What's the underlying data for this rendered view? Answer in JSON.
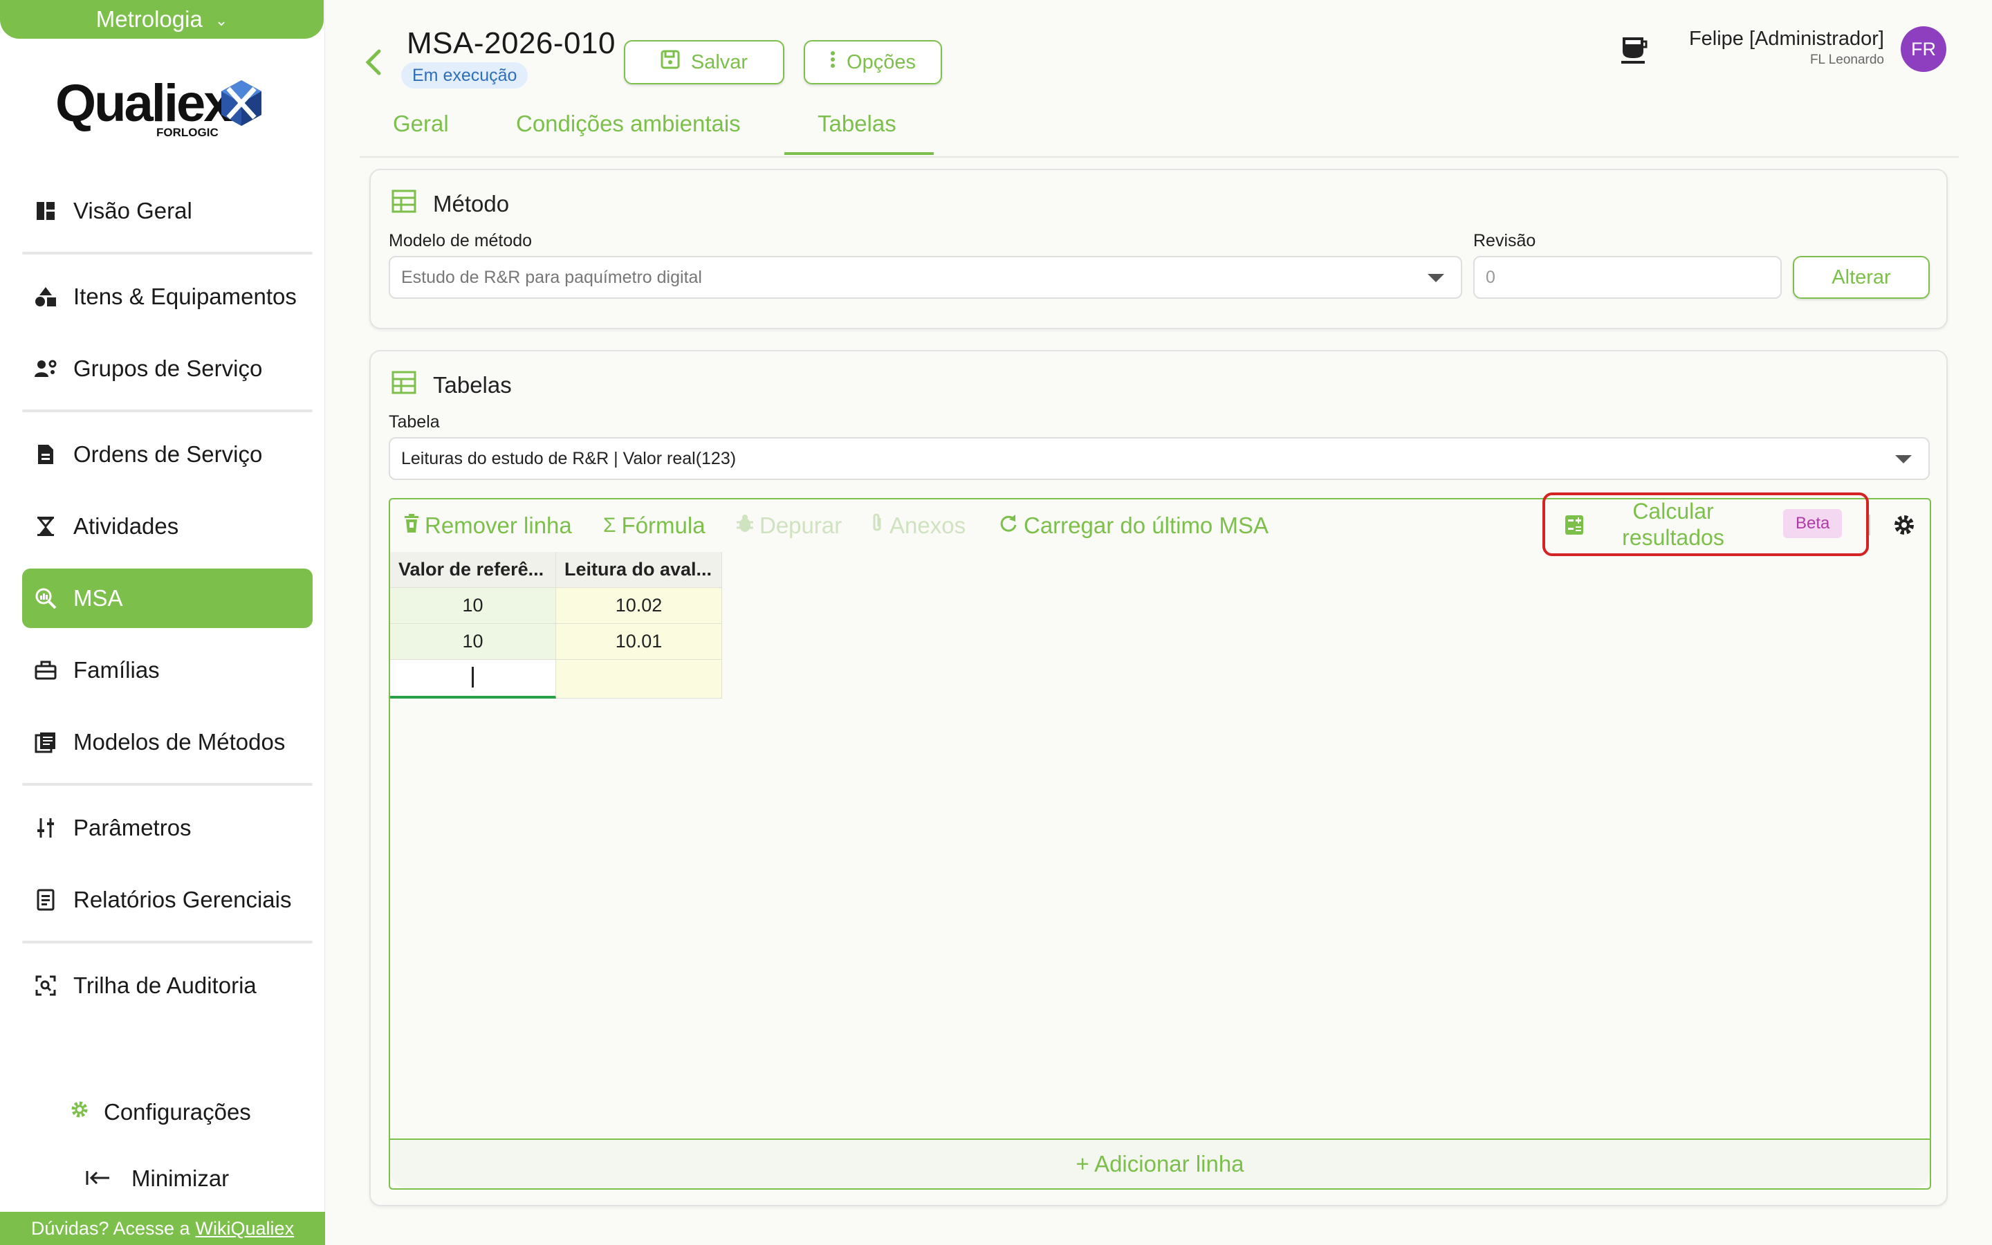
{
  "sidebar": {
    "module": "Metrologia",
    "logo_text": "Qualiex",
    "logo_sub": "FORLOGIC",
    "items": [
      {
        "label": "Visão Geral",
        "icon": "dashboard-icon"
      },
      {
        "label": "Itens & Equipamentos",
        "icon": "shapes-icon"
      },
      {
        "label": "Grupos de Serviço",
        "icon": "users-gear-icon"
      },
      {
        "label": "Ordens de Serviço",
        "icon": "document-icon"
      },
      {
        "label": "Atividades",
        "icon": "hourglass-icon"
      },
      {
        "label": "MSA",
        "icon": "search-analytics-icon"
      },
      {
        "label": "Famílias",
        "icon": "toolbox-icon"
      },
      {
        "label": "Modelos de Métodos",
        "icon": "library-icon"
      },
      {
        "label": "Parâmetros",
        "icon": "sliders-icon"
      },
      {
        "label": "Relatórios Gerenciais",
        "icon": "report-icon"
      },
      {
        "label": "Trilha de Auditoria",
        "icon": "audit-icon"
      }
    ],
    "settings_label": "Configurações",
    "minimize_label": "Minimizar",
    "help_text": "Dúvidas? Acesse a",
    "help_link": "WikiQualiex"
  },
  "header": {
    "title": "MSA-2026-010",
    "status": "Em execução",
    "save_label": "Salvar",
    "options_label": "Opções",
    "user_name": "Felipe [Administrador]",
    "user_org": "FL Leonardo",
    "avatar_initials": "FR"
  },
  "tabs": [
    {
      "label": "Geral",
      "active": false
    },
    {
      "label": "Condições ambientais",
      "active": false
    },
    {
      "label": "Tabelas",
      "active": true
    }
  ],
  "method": {
    "title": "Método",
    "model_label": "Modelo de método",
    "model_value": "Estudo de R&R para paquímetro digital",
    "revision_label": "Revisão",
    "revision_value": "0",
    "alter_label": "Alterar"
  },
  "tables": {
    "title": "Tabelas",
    "table_label": "Tabela",
    "table_value": "Leituras do estudo de R&R | Valor real(123)",
    "toolbar": {
      "remove_row": "Remover linha",
      "formula": "Fórmula",
      "debug": "Depurar",
      "attachments": "Anexos",
      "load_last": "Carregar do último MSA",
      "calculate": "Calcular resultados",
      "beta": "Beta"
    },
    "columns": [
      "Valor de referê...",
      "Leitura do aval..."
    ],
    "rows": [
      [
        "10",
        "10.02"
      ],
      [
        "10",
        "10.01"
      ]
    ],
    "add_row": "+ Adicionar linha"
  },
  "colors": {
    "accent": "#7cc04b",
    "highlight": "#d32323",
    "avatar": "#8e3fbf",
    "badge_bg": "#e3eefc",
    "badge_text": "#2f6fb8"
  }
}
